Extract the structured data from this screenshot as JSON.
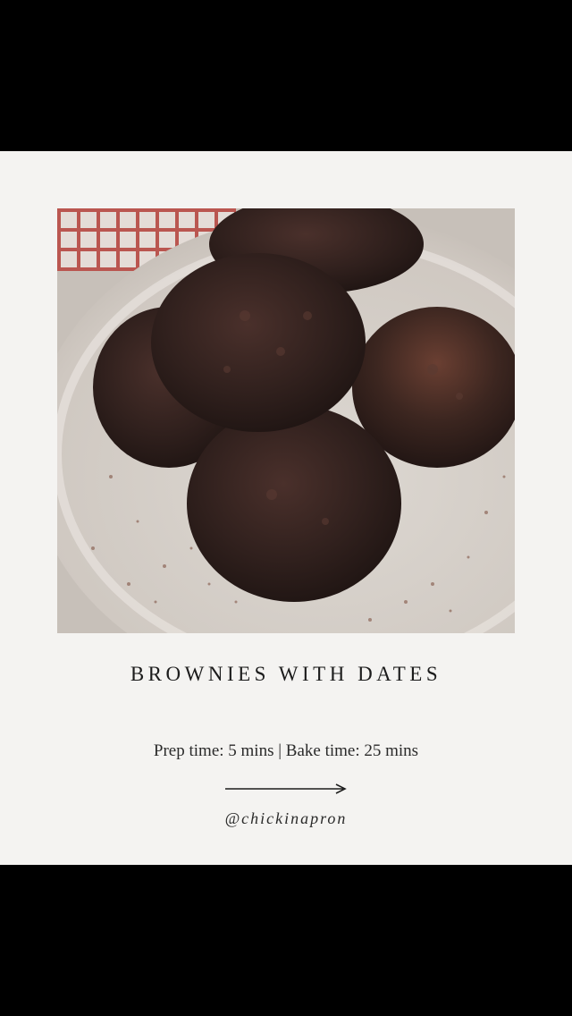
{
  "recipe": {
    "title": "BROWNIES WITH DATES",
    "times": "Prep time: 5 mins | Bake time: 25 mins",
    "handle": "@chickinapron"
  },
  "colors": {
    "card_background": "#f4f3f1",
    "text": "#1c1c1c",
    "letterbox": "#000000"
  },
  "icons": {
    "arrow": "arrow-right-icon"
  }
}
